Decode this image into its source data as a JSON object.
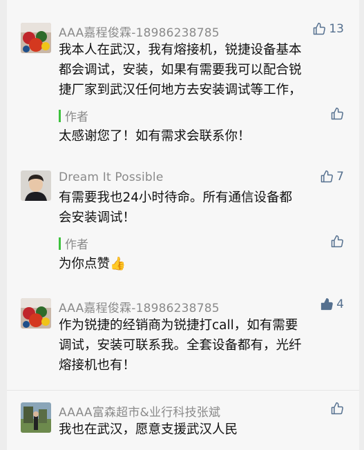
{
  "comments": [
    {
      "username": "AAA嘉程俊霖-18986238785",
      "likes": "13",
      "liked": false,
      "text": "我本人在武汉，我有熔接机，锐捷设备基本\n都会调试，安装，如果有需要我可以配合锐\n捷厂家到武汉任何地方去安装调试等工作，",
      "author_reply": {
        "tag": "作者",
        "text": "太感谢您了！如有需求会联系你！"
      }
    },
    {
      "username": "Dream It Possible",
      "likes": "7",
      "liked": false,
      "text": "有需要我也24小时待命。所有通信设备都\n会安装调试！",
      "author_reply": {
        "tag": "作者",
        "text": "为你点赞",
        "emoji": "👍"
      }
    },
    {
      "username": "AAA嘉程俊霖-18986238785",
      "likes": "4",
      "liked": true,
      "text": "作为锐捷的经销商为锐捷打call，如有需要\n调试，安装可联系我。全套设备都有，光纤\n熔接机也有！"
    },
    {
      "username": "AAAA富森超市&业行科技张斌",
      "likes": "",
      "liked": false,
      "text": "我也在武汉，愿意支援武汉人民"
    }
  ],
  "colors": {
    "link_blue": "#55708f",
    "author_bar": "#3ec23e",
    "meta_gray": "#8a8a8a"
  },
  "icons": {
    "like": "thumbs-up-outline-icon",
    "liked": "thumbs-up-filled-icon"
  }
}
